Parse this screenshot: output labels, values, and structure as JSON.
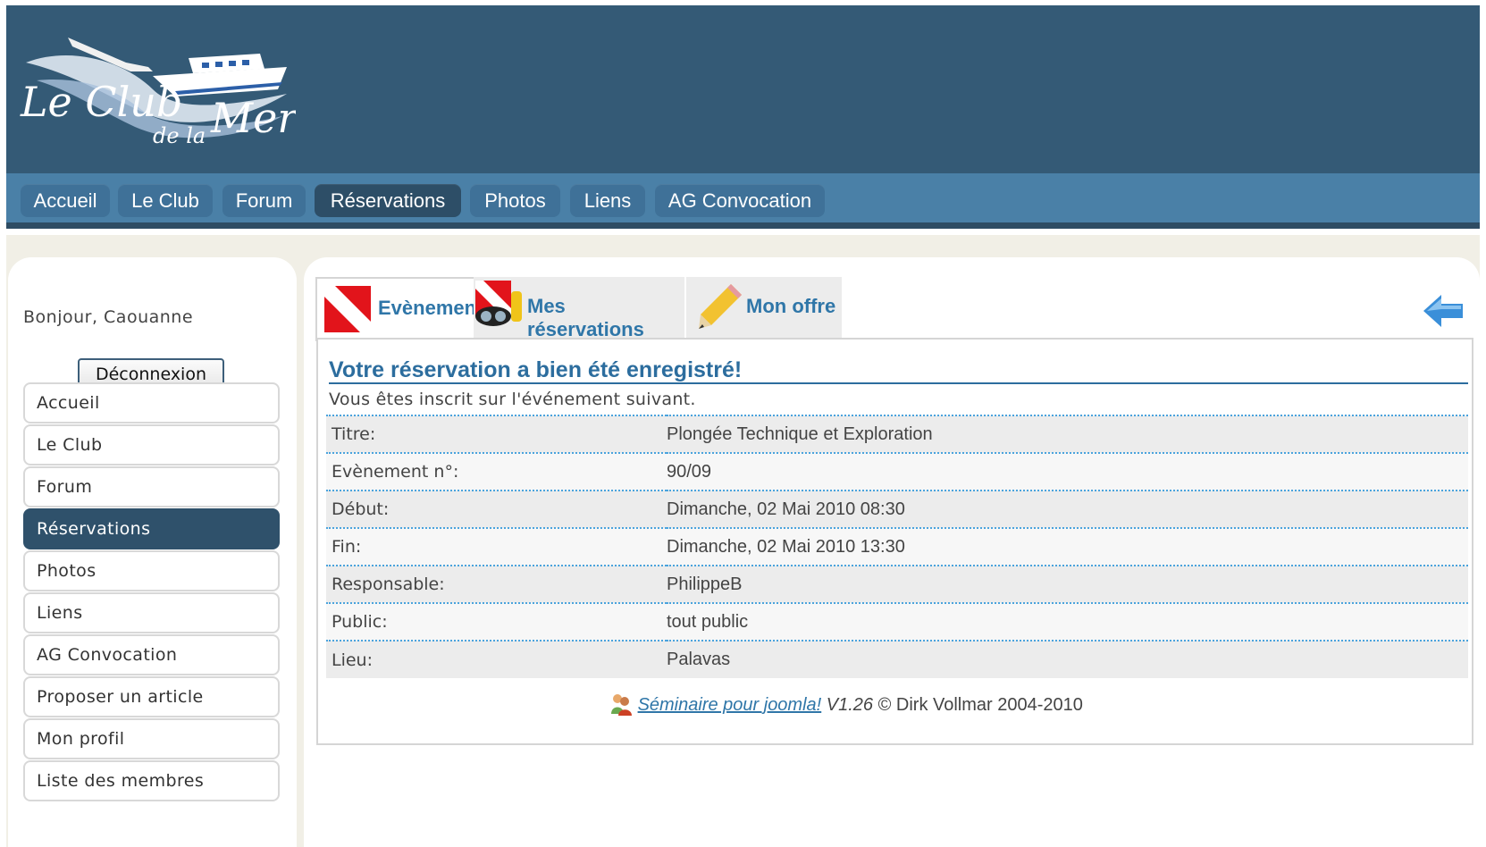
{
  "brand": {
    "line1": "Le Club",
    "line2": "de la",
    "line3": "Mer"
  },
  "topnav": [
    "Accueil",
    "Le Club",
    "Forum",
    "Réservations",
    "Photos",
    "Liens",
    "AG Convocation"
  ],
  "sidebar": {
    "greeting": "Bonjour, Caouanne",
    "logout": "Déconnexion",
    "items": [
      "Accueil",
      "Le Club",
      "Forum",
      "Réservations",
      "Photos",
      "Liens",
      "AG Convocation",
      "Proposer un article",
      "Mon profil",
      "Liste des membres"
    ]
  },
  "tabs": [
    {
      "label": "Evènement",
      "icon": "dive-flag-icon"
    },
    {
      "label": "Mes réservations",
      "icon": "diver-mask-icon"
    },
    {
      "label": "Mon offre",
      "icon": "pencil-icon"
    }
  ],
  "main": {
    "title": "Votre réservation a bien été enregistré!",
    "intro": "Vous êtes inscrit sur l'événement suivant.",
    "rows": [
      {
        "label": "Titre:",
        "value": "Plongée Technique et Exploration"
      },
      {
        "label": "Evènement n°:",
        "value": "90/09"
      },
      {
        "label": "Début:",
        "value": "Dimanche, 02 Mai 2010 08:30"
      },
      {
        "label": "Fin:",
        "value": "Dimanche, 02 Mai 2010 13:30"
      },
      {
        "label": "Responsable:",
        "value": "PhilippeB"
      },
      {
        "label": "Public:",
        "value": "tout public"
      },
      {
        "label": "Lieu:",
        "value": "Palavas"
      }
    ]
  },
  "footer": {
    "link": "Séminaire pour joomla!",
    "version": "V1.26",
    "copyright": "© Dirk Vollmar 2004-2010"
  },
  "colors": {
    "header": "#345a76",
    "nav": "#4a80a7",
    "accent": "#2f76a8",
    "active": "#2f516b"
  }
}
